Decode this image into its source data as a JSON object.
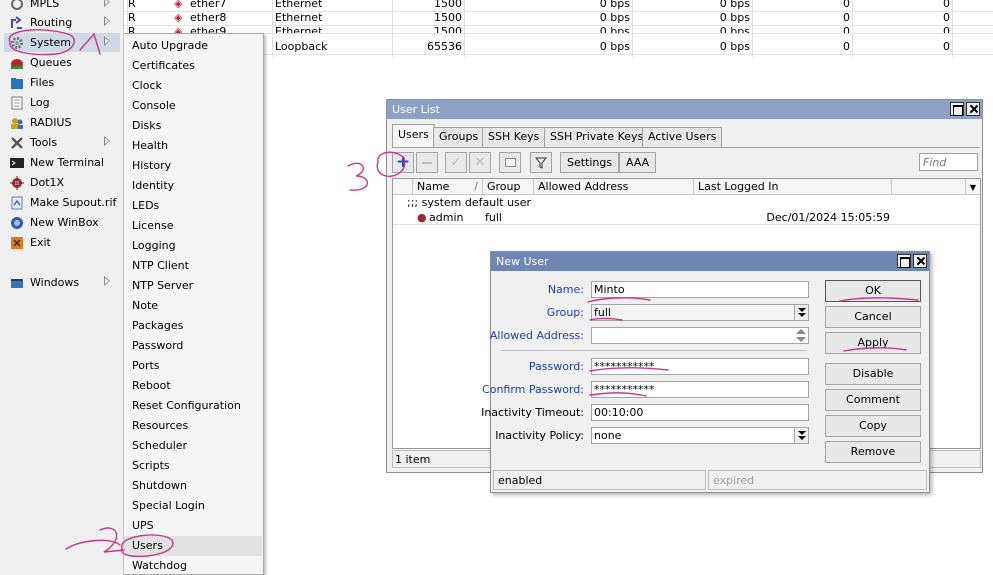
{
  "sidebar": {
    "items": [
      {
        "label": "MPLS",
        "icon": "mpls-icon",
        "arrow": true
      },
      {
        "label": "Routing",
        "icon": "routing-icon",
        "arrow": true
      },
      {
        "label": "System",
        "icon": "gear-icon",
        "arrow": true
      },
      {
        "label": "Queues",
        "icon": "queues-icon",
        "arrow": false
      },
      {
        "label": "Files",
        "icon": "folder-icon",
        "arrow": false
      },
      {
        "label": "Log",
        "icon": "log-icon",
        "arrow": false
      },
      {
        "label": "RADIUS",
        "icon": "radius-icon",
        "arrow": false
      },
      {
        "label": "Tools",
        "icon": "tools-icon",
        "arrow": true
      },
      {
        "label": "New Terminal",
        "icon": "terminal-icon",
        "arrow": false
      },
      {
        "label": "Dot1X",
        "icon": "dot1x-icon",
        "arrow": false
      },
      {
        "label": "Make Supout.rif",
        "icon": "supout-icon",
        "arrow": false
      },
      {
        "label": "New WinBox",
        "icon": "winbox-icon",
        "arrow": false
      },
      {
        "label": "Exit",
        "icon": "exit-icon",
        "arrow": false
      },
      {
        "label": "Windows",
        "icon": "windows-icon",
        "arrow": true
      }
    ]
  },
  "submenu": {
    "items": [
      "Auto Upgrade",
      "Certificates",
      "Clock",
      "Console",
      "Disks",
      "Health",
      "History",
      "Identity",
      "LEDs",
      "License",
      "Logging",
      "NTP Client",
      "NTP Server",
      "Note",
      "Packages",
      "Password",
      "Ports",
      "Reboot",
      "Reset Configuration",
      "Resources",
      "Scheduler",
      "Scripts",
      "Shutdown",
      "Special Login",
      "UPS",
      "Users",
      "Watchdog"
    ]
  },
  "interfaces": {
    "rows": [
      {
        "flag": "R",
        "name": "ether7",
        "type": "Ethernet",
        "mtu": "1500",
        "tx": "0 bps",
        "rx": "0 bps",
        "a": "0",
        "b": "0"
      },
      {
        "flag": "R",
        "name": "ether8",
        "type": "Ethernet",
        "mtu": "1500",
        "tx": "0 bps",
        "rx": "0 bps",
        "a": "0",
        "b": "0"
      },
      {
        "flag": "R",
        "name": "ether9",
        "type": "Ethernet",
        "mtu": "1500",
        "tx": "0 bps",
        "rx": "0 bps",
        "a": "0",
        "b": "0"
      },
      {
        "flag": "",
        "name": "",
        "type": "Loopback",
        "mtu": "65536",
        "tx": "0 bps",
        "rx": "0 bps",
        "a": "0",
        "b": "0"
      }
    ]
  },
  "user_list": {
    "title": "User List",
    "tabs": [
      "Users",
      "Groups",
      "SSH Keys",
      "SSH Private Keys",
      "Active Users"
    ],
    "toolbar": {
      "settings": "Settings",
      "aaa": "AAA",
      "find_placeholder": "Find"
    },
    "columns": [
      "Name",
      "Group",
      "Allowed Address",
      "Last Logged In"
    ],
    "comment_row": ";;; system default user",
    "users": [
      {
        "name": "admin",
        "group": "full",
        "allowed_address": "",
        "last_logged_in": "Dec/01/2024 15:05:59"
      }
    ],
    "status": "1 item"
  },
  "new_user": {
    "title": "New User",
    "fields": {
      "name": {
        "label": "Name:",
        "value": "Minto"
      },
      "group": {
        "label": "Group:",
        "value": "full"
      },
      "allowed_address": {
        "label": "Allowed Address:",
        "value": ""
      },
      "password": {
        "label": "Password:",
        "value": "***********"
      },
      "confirm_password": {
        "label": "Confirm Password:",
        "value": "***********"
      },
      "inactivity_timeout": {
        "label": "Inactivity Timeout:",
        "value": "00:10:00"
      },
      "inactivity_policy": {
        "label": "Inactivity Policy:",
        "value": "none"
      }
    },
    "buttons": [
      "OK",
      "Cancel",
      "Apply",
      "Disable",
      "Comment",
      "Copy",
      "Remove"
    ],
    "status": {
      "left": "enabled",
      "right": "expired"
    }
  },
  "annotations": {
    "a1": "1",
    "a2": "2",
    "a3": "3"
  },
  "colors": {
    "annotation": "#c9388c",
    "title_bar": "#8da1c4",
    "dialog_title": "#6f85b3",
    "label_blue": "#1b3fae",
    "add_blue": "#1b4fd6"
  }
}
